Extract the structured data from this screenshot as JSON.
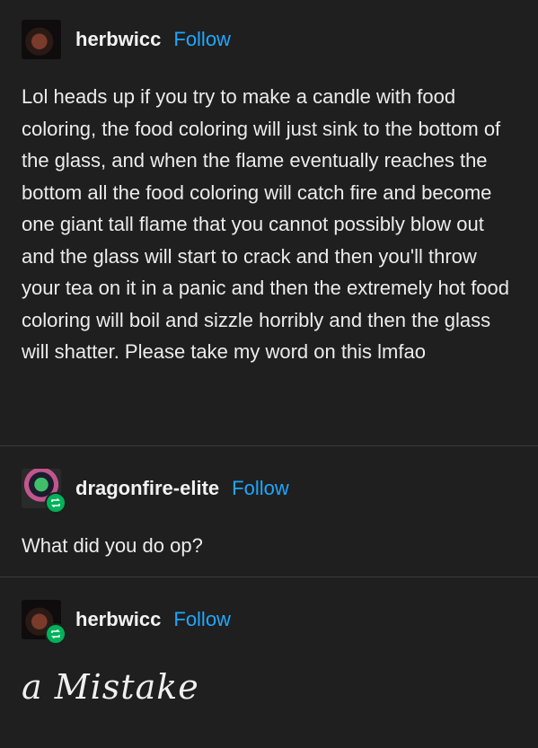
{
  "posts": [
    {
      "username": "herbwicc",
      "follow_label": "Follow",
      "avatar_icon": "herbwicc-avatar",
      "reblogged": false,
      "text": "Lol heads up if you try to make a candle with food coloring, the food coloring will just sink to the bottom of the glass, and when the flame eventually reaches the bottom all the food coloring will catch fire and become one giant tall flame that you cannot possibly blow out and the glass will start to crack and then you'll throw your tea on it in a panic and then the extremely hot food coloring will boil and sizzle horribly and then the glass will shatter. Please take my word on this lmfao"
    },
    {
      "username": "dragonfire-elite",
      "follow_label": "Follow",
      "avatar_icon": "dragonfire-avatar",
      "reblogged": true,
      "text": "What did you do op?"
    },
    {
      "username": "herbwicc",
      "follow_label": "Follow",
      "avatar_icon": "herbwicc-avatar",
      "reblogged": true,
      "text": "a Mistake"
    }
  ],
  "colors": {
    "background": "#1f1f1f",
    "follow_link": "#1ea7ff",
    "reblog_badge": "#00b25a",
    "divider": "#3a3a3a"
  }
}
